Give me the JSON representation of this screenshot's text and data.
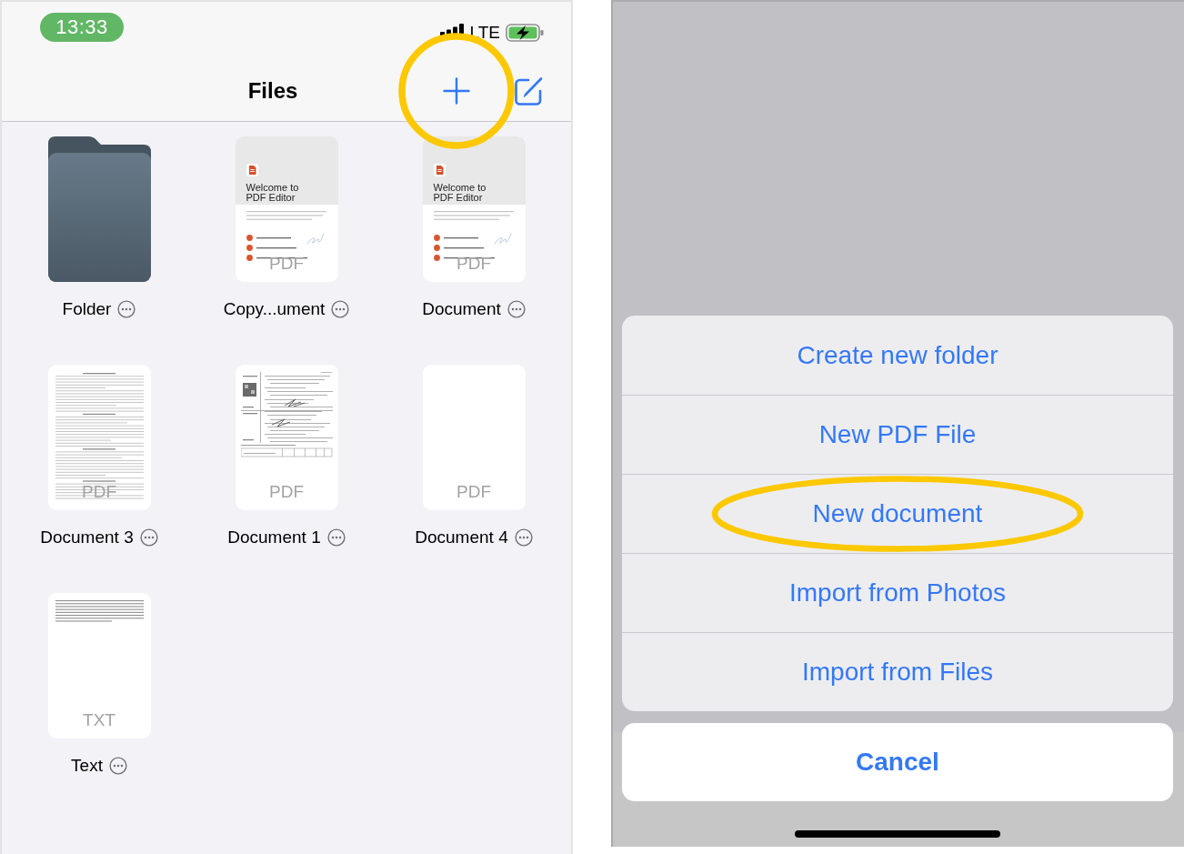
{
  "left_screen": {
    "status_bar": {
      "time": "13:33",
      "network": "LTE"
    },
    "nav_bar": {
      "title": "Files",
      "buttons": [
        {
          "kind": "add",
          "highlighted": true
        },
        {
          "kind": "compose",
          "highlighted": false
        }
      ]
    },
    "files": [
      {
        "name": "Folder",
        "kind": "folder"
      },
      {
        "name": "Copy...ument",
        "kind": "welcome",
        "type_label": "PDF",
        "preview": {
          "title": "Welcome to PDF Editor"
        }
      },
      {
        "name": "Document",
        "kind": "welcome",
        "type_label": "PDF",
        "preview": {
          "title": "Welcome to PDF Editor"
        }
      },
      {
        "name": "Document 3",
        "kind": "article",
        "type_label": "PDF"
      },
      {
        "name": "Document 1",
        "kind": "form",
        "type_label": "PDF"
      },
      {
        "name": "Document 4",
        "kind": "blank",
        "type_label": "PDF"
      },
      {
        "name": "Text",
        "kind": "text",
        "type_label": "TXT"
      }
    ]
  },
  "right_screen": {
    "action_sheet": {
      "actions": [
        {
          "label": "Create new folder",
          "highlighted": false
        },
        {
          "label": "New PDF File",
          "highlighted": false
        },
        {
          "label": "New document",
          "highlighted": true
        },
        {
          "label": "Import from Photos",
          "highlighted": false
        },
        {
          "label": "Import from Files",
          "highlighted": false
        }
      ],
      "cancel": "Cancel"
    }
  }
}
